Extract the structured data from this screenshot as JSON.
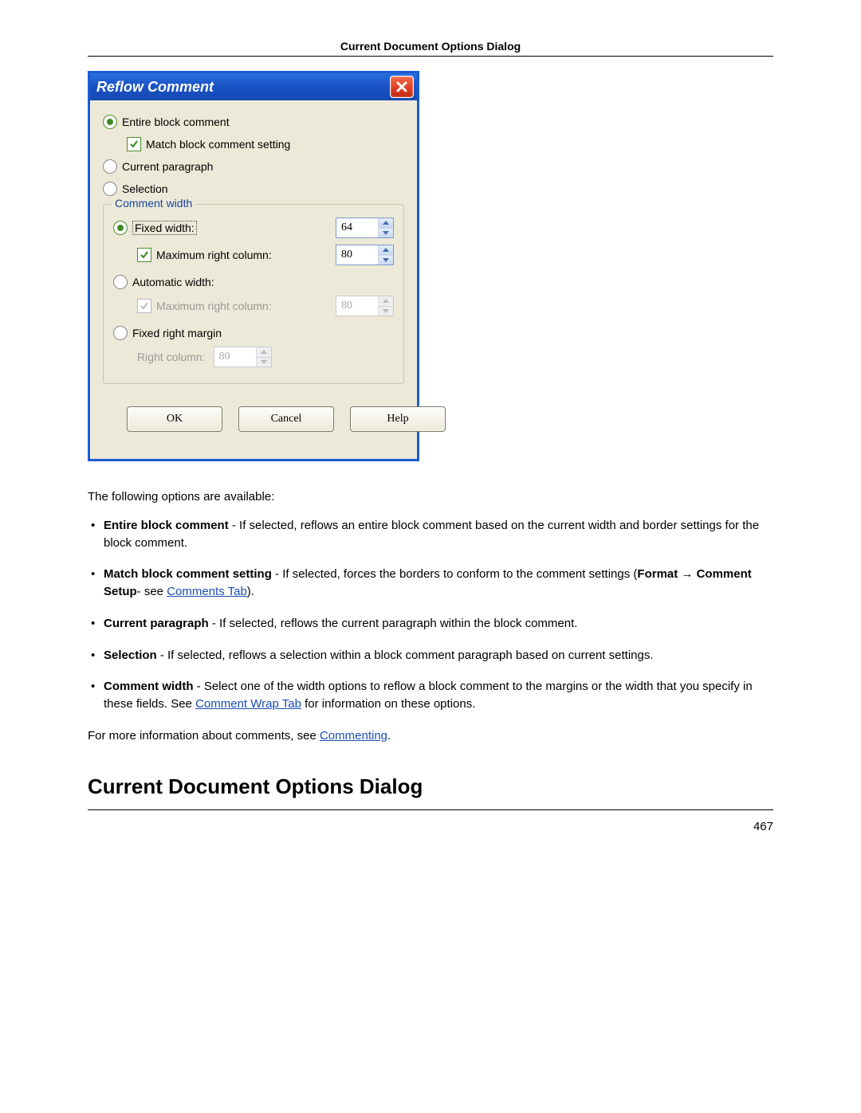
{
  "header": {
    "title": "Current Document Options Dialog"
  },
  "dialog": {
    "title": "Reflow Comment",
    "options": {
      "entire_block": {
        "label": "Entire block comment",
        "selected": true
      },
      "match_setting": {
        "label": "Match block comment setting",
        "checked": true
      },
      "current_paragraph": {
        "label": "Current paragraph",
        "selected": false
      },
      "selection": {
        "label": "Selection",
        "selected": false
      }
    },
    "comment_width": {
      "legend": "Comment width",
      "fixed": {
        "label": "Fixed width:",
        "selected": true,
        "value": "64"
      },
      "fixed_max": {
        "label": "Maximum right column:",
        "checked": true,
        "value": "80"
      },
      "auto": {
        "label": "Automatic width:",
        "selected": false
      },
      "auto_max": {
        "label": "Maximum right column:",
        "checked": true,
        "value": "80",
        "disabled": true
      },
      "fixed_margin": {
        "label": "Fixed right margin",
        "selected": false
      },
      "right_column": {
        "label": "Right column:",
        "value": "80",
        "disabled": true
      }
    },
    "buttons": {
      "ok": "OK",
      "cancel": "Cancel",
      "help": "Help"
    }
  },
  "doc": {
    "intro": "The following options are available:",
    "items": [
      {
        "term": "Entire block comment",
        "desc": " - If selected, reflows an entire block comment based on the current width and border settings for the block comment."
      },
      {
        "term": "Match block comment setting",
        "desc_prefix": " - If selected, forces the borders to conform to the comment settings (",
        "path": "Format → Comment Setup",
        "desc_mid": "- see ",
        "link": "Comments Tab",
        "desc_suffix": ")."
      },
      {
        "term": "Current paragraph",
        "desc": " - If selected, reflows the current paragraph within the block comment."
      },
      {
        "term": "Selection",
        "desc": " - If selected, reflows a selection within a block comment paragraph based on current settings."
      },
      {
        "term": "Comment width",
        "desc_prefix": " - Select one of the width options to reflow a block comment to the margins or the width that you specify in these fields. See ",
        "link": "Comment Wrap Tab",
        "desc_suffix": " for information on these options."
      }
    ],
    "more_prefix": "For more information about comments, see ",
    "more_link": "Commenting",
    "more_suffix": ".",
    "section_heading": "Current Document Options Dialog",
    "page_number": "467"
  }
}
